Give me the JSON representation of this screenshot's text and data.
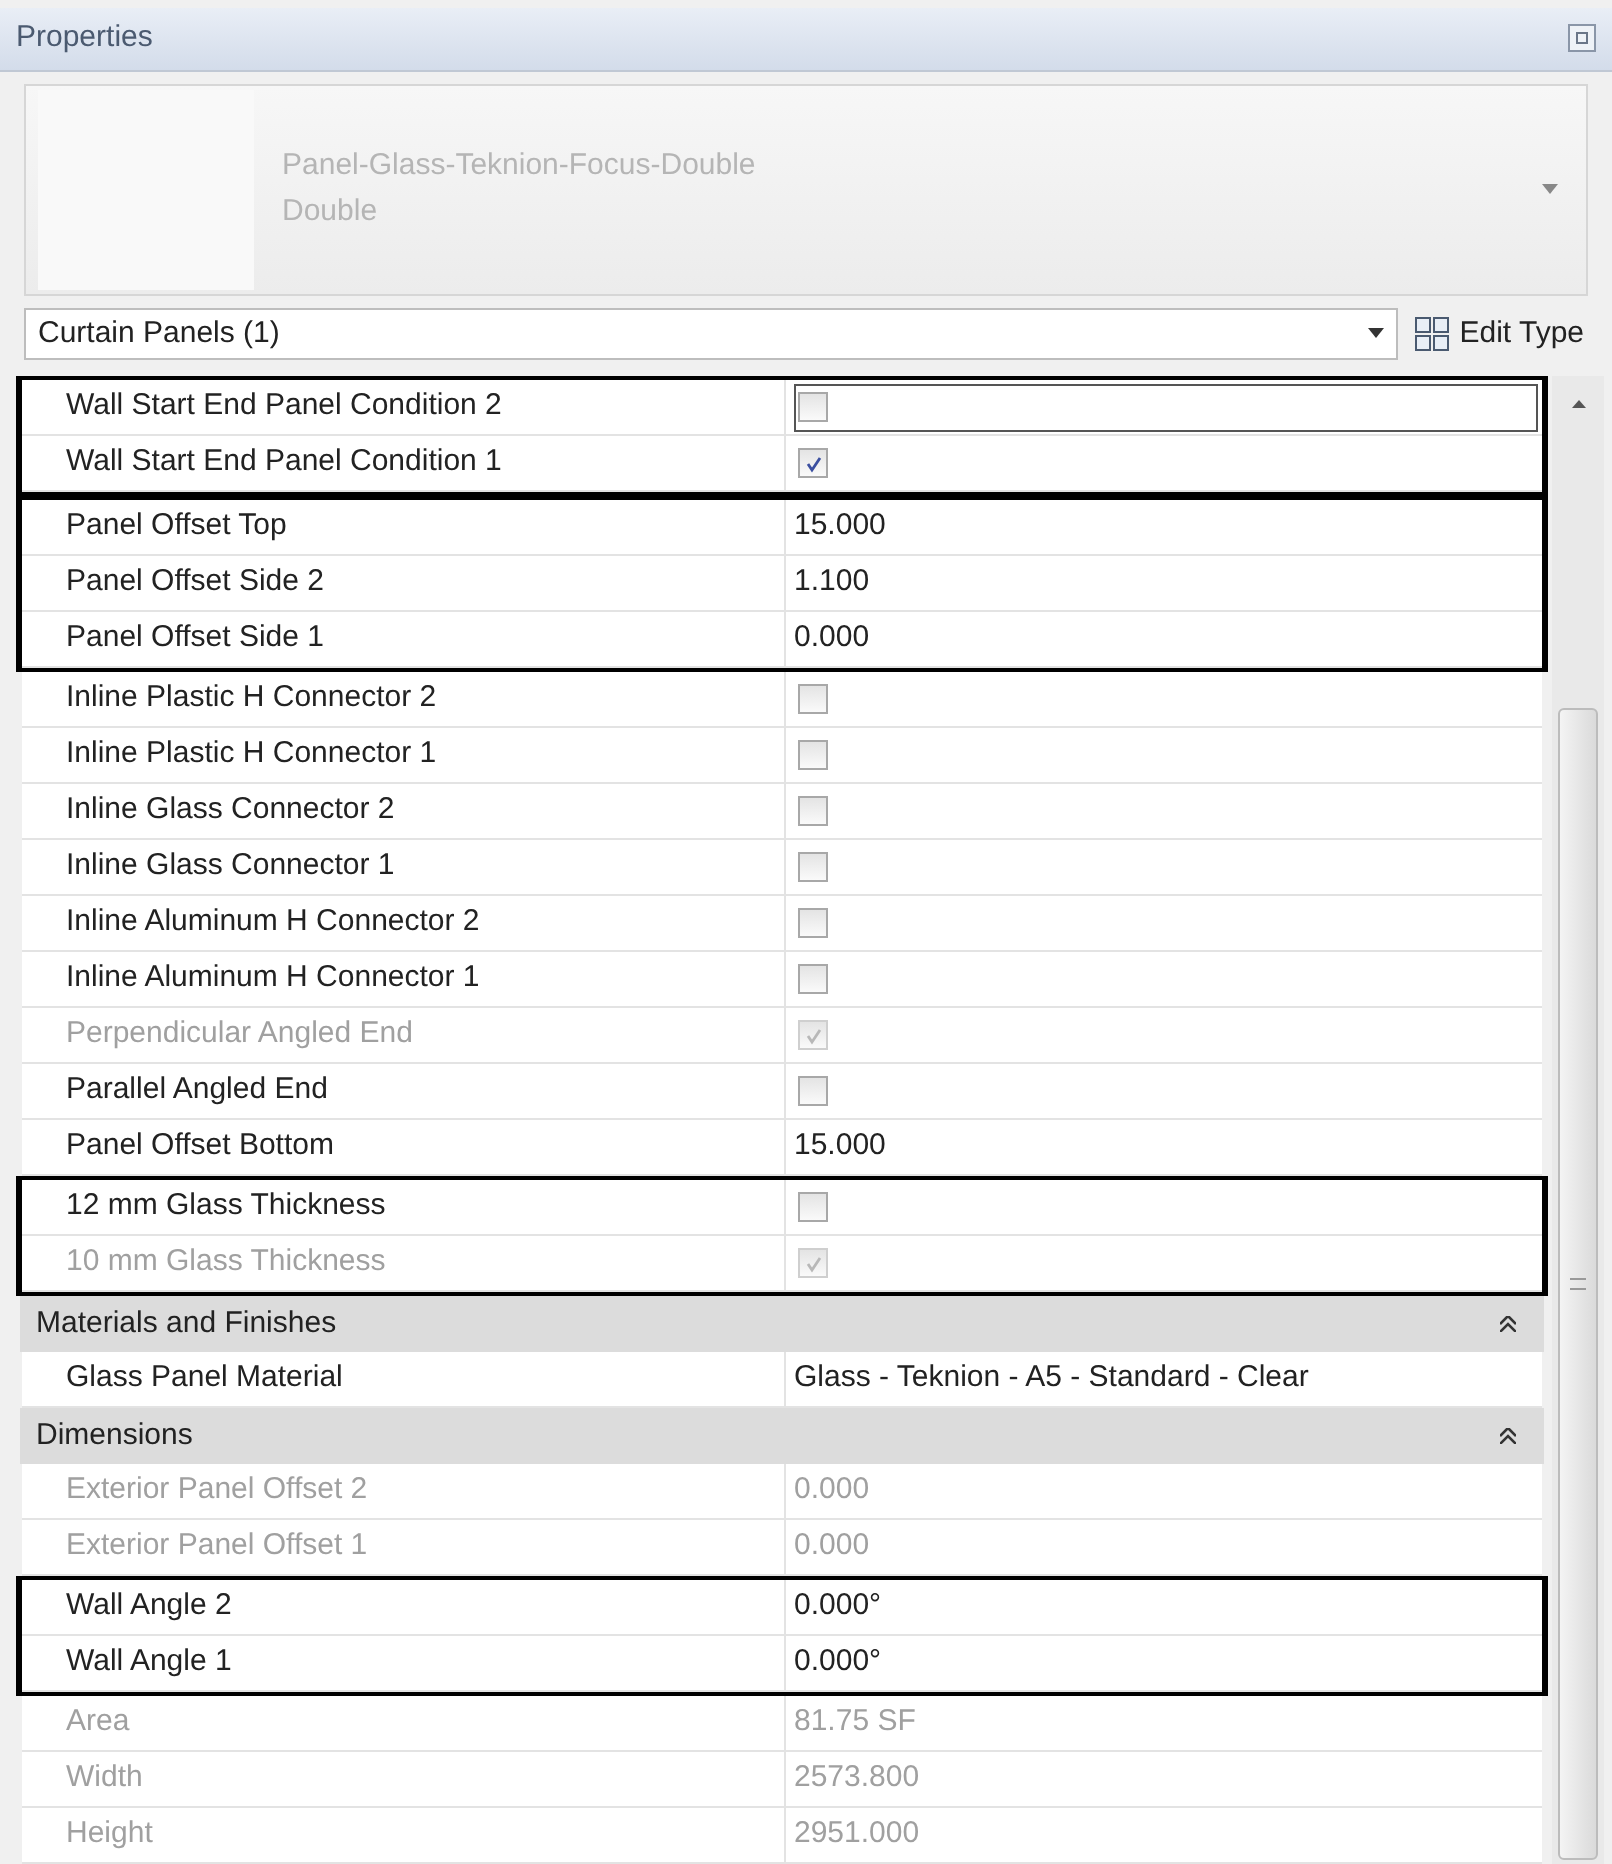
{
  "panel": {
    "title": "Properties"
  },
  "type_selector": {
    "family": "Panel-Glass-Teknion-Focus-Double",
    "type": "Double"
  },
  "filter": {
    "value": "Curtain Panels (1)",
    "edit_type": "Edit Type"
  },
  "sections": [
    {
      "blocks": [
        {
          "outlined": true,
          "rows": [
            {
              "kind": "checkbox",
              "label": "Wall Start End Panel Condition 2",
              "checked": false,
              "disabled": false,
              "focused": true
            },
            {
              "kind": "checkbox",
              "label": "Wall Start End Panel Condition 1",
              "checked": true,
              "disabled": false,
              "focused": false
            }
          ]
        },
        {
          "outlined": true,
          "rows": [
            {
              "kind": "text",
              "label": "Panel Offset Top",
              "value": "15.000",
              "disabled": false
            },
            {
              "kind": "text",
              "label": "Panel Offset Side 2",
              "value": "1.100",
              "disabled": false
            },
            {
              "kind": "text",
              "label": "Panel Offset Side 1",
              "value": "0.000",
              "disabled": false
            }
          ]
        },
        {
          "outlined": false,
          "rows": [
            {
              "kind": "checkbox",
              "label": "Inline Plastic H Connector 2",
              "checked": false,
              "disabled": false,
              "focused": false
            },
            {
              "kind": "checkbox",
              "label": "Inline Plastic H Connector 1",
              "checked": false,
              "disabled": false,
              "focused": false
            },
            {
              "kind": "checkbox",
              "label": "Inline Glass Connector 2",
              "checked": false,
              "disabled": false,
              "focused": false
            },
            {
              "kind": "checkbox",
              "label": "Inline Glass Connector 1",
              "checked": false,
              "disabled": false,
              "focused": false
            },
            {
              "kind": "checkbox",
              "label": "Inline Aluminum H Connector 2",
              "checked": false,
              "disabled": false,
              "focused": false
            },
            {
              "kind": "checkbox",
              "label": "Inline Aluminum H Connector 1",
              "checked": false,
              "disabled": false,
              "focused": false
            },
            {
              "kind": "checkbox",
              "label": "Perpendicular Angled End",
              "checked": true,
              "disabled": true,
              "focused": false
            },
            {
              "kind": "checkbox",
              "label": "Parallel Angled End",
              "checked": false,
              "disabled": false,
              "focused": false
            },
            {
              "kind": "text",
              "label": "Panel Offset Bottom",
              "value": "15.000",
              "disabled": false
            }
          ]
        },
        {
          "outlined": true,
          "rows": [
            {
              "kind": "checkbox",
              "label": "12 mm Glass Thickness",
              "checked": false,
              "disabled": false,
              "focused": false
            },
            {
              "kind": "checkbox",
              "label": "10 mm Glass Thickness",
              "checked": true,
              "disabled": true,
              "focused": false
            }
          ]
        }
      ]
    },
    {
      "header": "Materials and Finishes",
      "expanded": true,
      "blocks": [
        {
          "outlined": false,
          "rows": [
            {
              "kind": "text",
              "label": "Glass Panel Material",
              "value": "Glass - Teknion - A5 - Standard - Clear",
              "disabled": false
            }
          ]
        }
      ]
    },
    {
      "header": "Dimensions",
      "expanded": true,
      "blocks": [
        {
          "outlined": false,
          "rows": [
            {
              "kind": "text",
              "label": "Exterior Panel Offset 2",
              "value": "0.000",
              "disabled": true
            },
            {
              "kind": "text",
              "label": "Exterior Panel Offset 1",
              "value": "0.000",
              "disabled": true
            }
          ]
        },
        {
          "outlined": true,
          "rows": [
            {
              "kind": "text",
              "label": "Wall Angle 2",
              "value": "0.000°",
              "disabled": false
            },
            {
              "kind": "text",
              "label": "Wall Angle 1",
              "value": "0.000°",
              "disabled": false
            }
          ]
        },
        {
          "outlined": false,
          "rows": [
            {
              "kind": "text",
              "label": "Area",
              "value": "81.75 SF",
              "disabled": true
            },
            {
              "kind": "text",
              "label": "Width",
              "value": "2573.800",
              "disabled": true
            },
            {
              "kind": "text",
              "label": "Height",
              "value": "2951.000",
              "disabled": true
            }
          ]
        }
      ]
    }
  ]
}
